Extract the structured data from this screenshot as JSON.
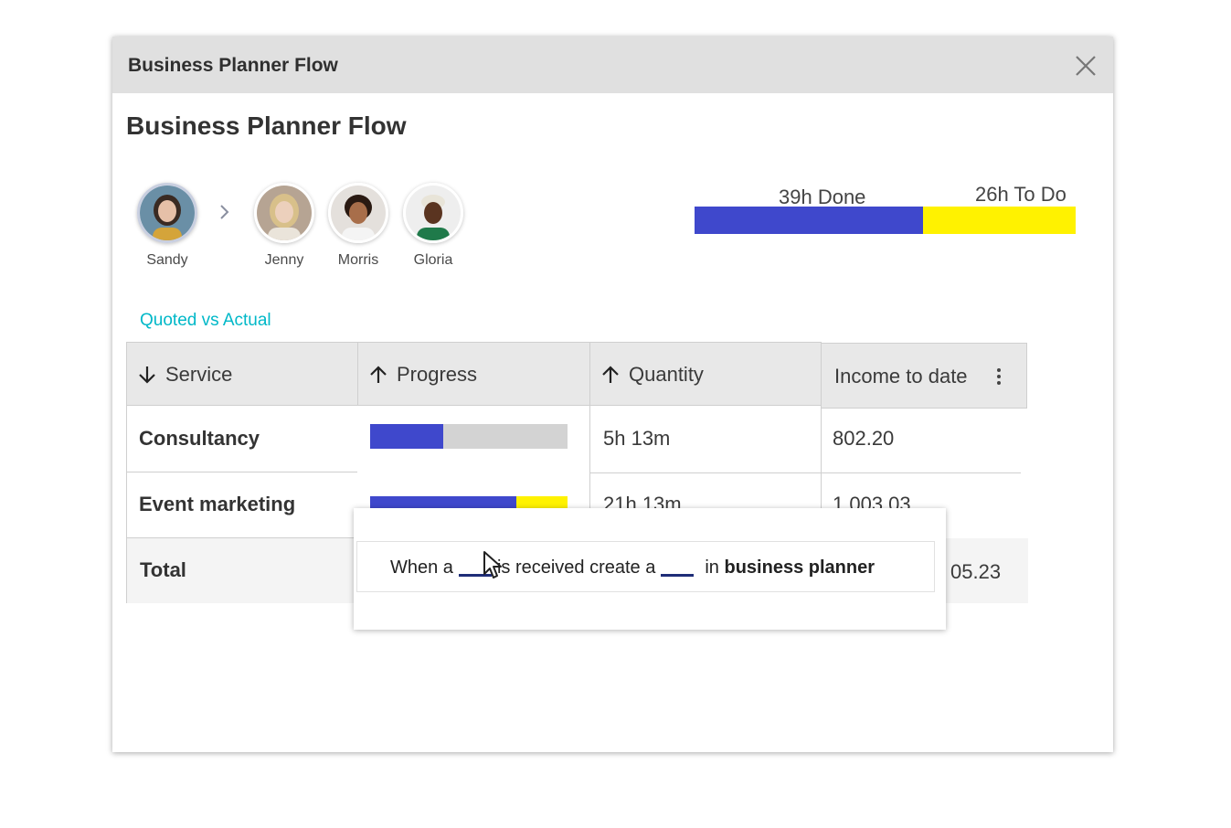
{
  "window": {
    "title": "Business Planner Flow"
  },
  "page": {
    "title": "Business Planner Flow"
  },
  "people": [
    {
      "name": "Sandy",
      "selected": true
    },
    {
      "name": "Jenny",
      "selected": false
    },
    {
      "name": "Morris",
      "selected": false
    },
    {
      "name": "Gloria",
      "selected": false
    }
  ],
  "hours": {
    "done_label": "39h Done",
    "todo_label": "26h To Do",
    "done_fraction": 0.6,
    "colors": {
      "done": "#3f48cc",
      "todo": "#fff200"
    }
  },
  "section": {
    "label": "Quoted vs Actual"
  },
  "table": {
    "columns": [
      {
        "label": "Service",
        "sort": "desc"
      },
      {
        "label": "Progress",
        "sort": "asc"
      },
      {
        "label": "Quantity",
        "sort": "asc"
      },
      {
        "label": "Income to date",
        "menu": true
      }
    ],
    "rows": [
      {
        "service": "Consultancy",
        "progress_done": 0.37,
        "progress_over": 0,
        "quantity": "5h 13m",
        "income": "802.20"
      },
      {
        "service": "Event marketing",
        "progress_done": 0.74,
        "progress_over": 0.26,
        "quantity": "21h 13m",
        "income": "1,003.03"
      }
    ],
    "total": {
      "label": "Total",
      "income": "05.23"
    }
  },
  "popup": {
    "text_1": "When a",
    "text_2": "is received create a",
    "text_3": "in",
    "text_bold": "business planner"
  }
}
